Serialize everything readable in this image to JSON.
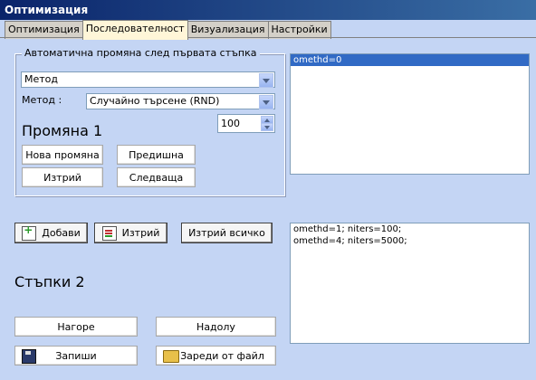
{
  "window": {
    "title": "Оптимизация"
  },
  "tabs": [
    {
      "label": "Оптимизация",
      "active": false
    },
    {
      "label": "Последователност",
      "active": true
    },
    {
      "label": "Визуализация",
      "active": false
    },
    {
      "label": "Настройки",
      "active": false
    }
  ],
  "auto_group": {
    "legend": "Автоматична промяна след първата стъпка",
    "param_combo_value": "Метод",
    "method_label": "Метод :",
    "method_combo_value": "Случайно търсене (RND)",
    "spin_value": "100",
    "change_heading": "Промяна 1",
    "new_change_button": "Нова промяна",
    "previous_button": "Предишна",
    "delete_button": "Изтрий",
    "next_button": "Следваща"
  },
  "top_list": {
    "items": [
      "omethd=0"
    ],
    "selected_index": 0
  },
  "steps": {
    "add_button": "Добави",
    "delete_button": "Изтрий",
    "delete_all_button": "Изтрий всичко",
    "heading": "Стъпки 2",
    "up_button": "Нагоре",
    "down_button": "Надолу",
    "save_button": "Запиши",
    "load_button": "Зареди от файл"
  },
  "steps_list": {
    "items": [
      "omethd=1; niters=100;",
      "omethd=4; niters=5000;"
    ]
  },
  "colors": {
    "background": "#c4d5f4",
    "selection": "#316ac5",
    "titlebar": "#0a246a",
    "active_tab": "#fff6d8"
  }
}
